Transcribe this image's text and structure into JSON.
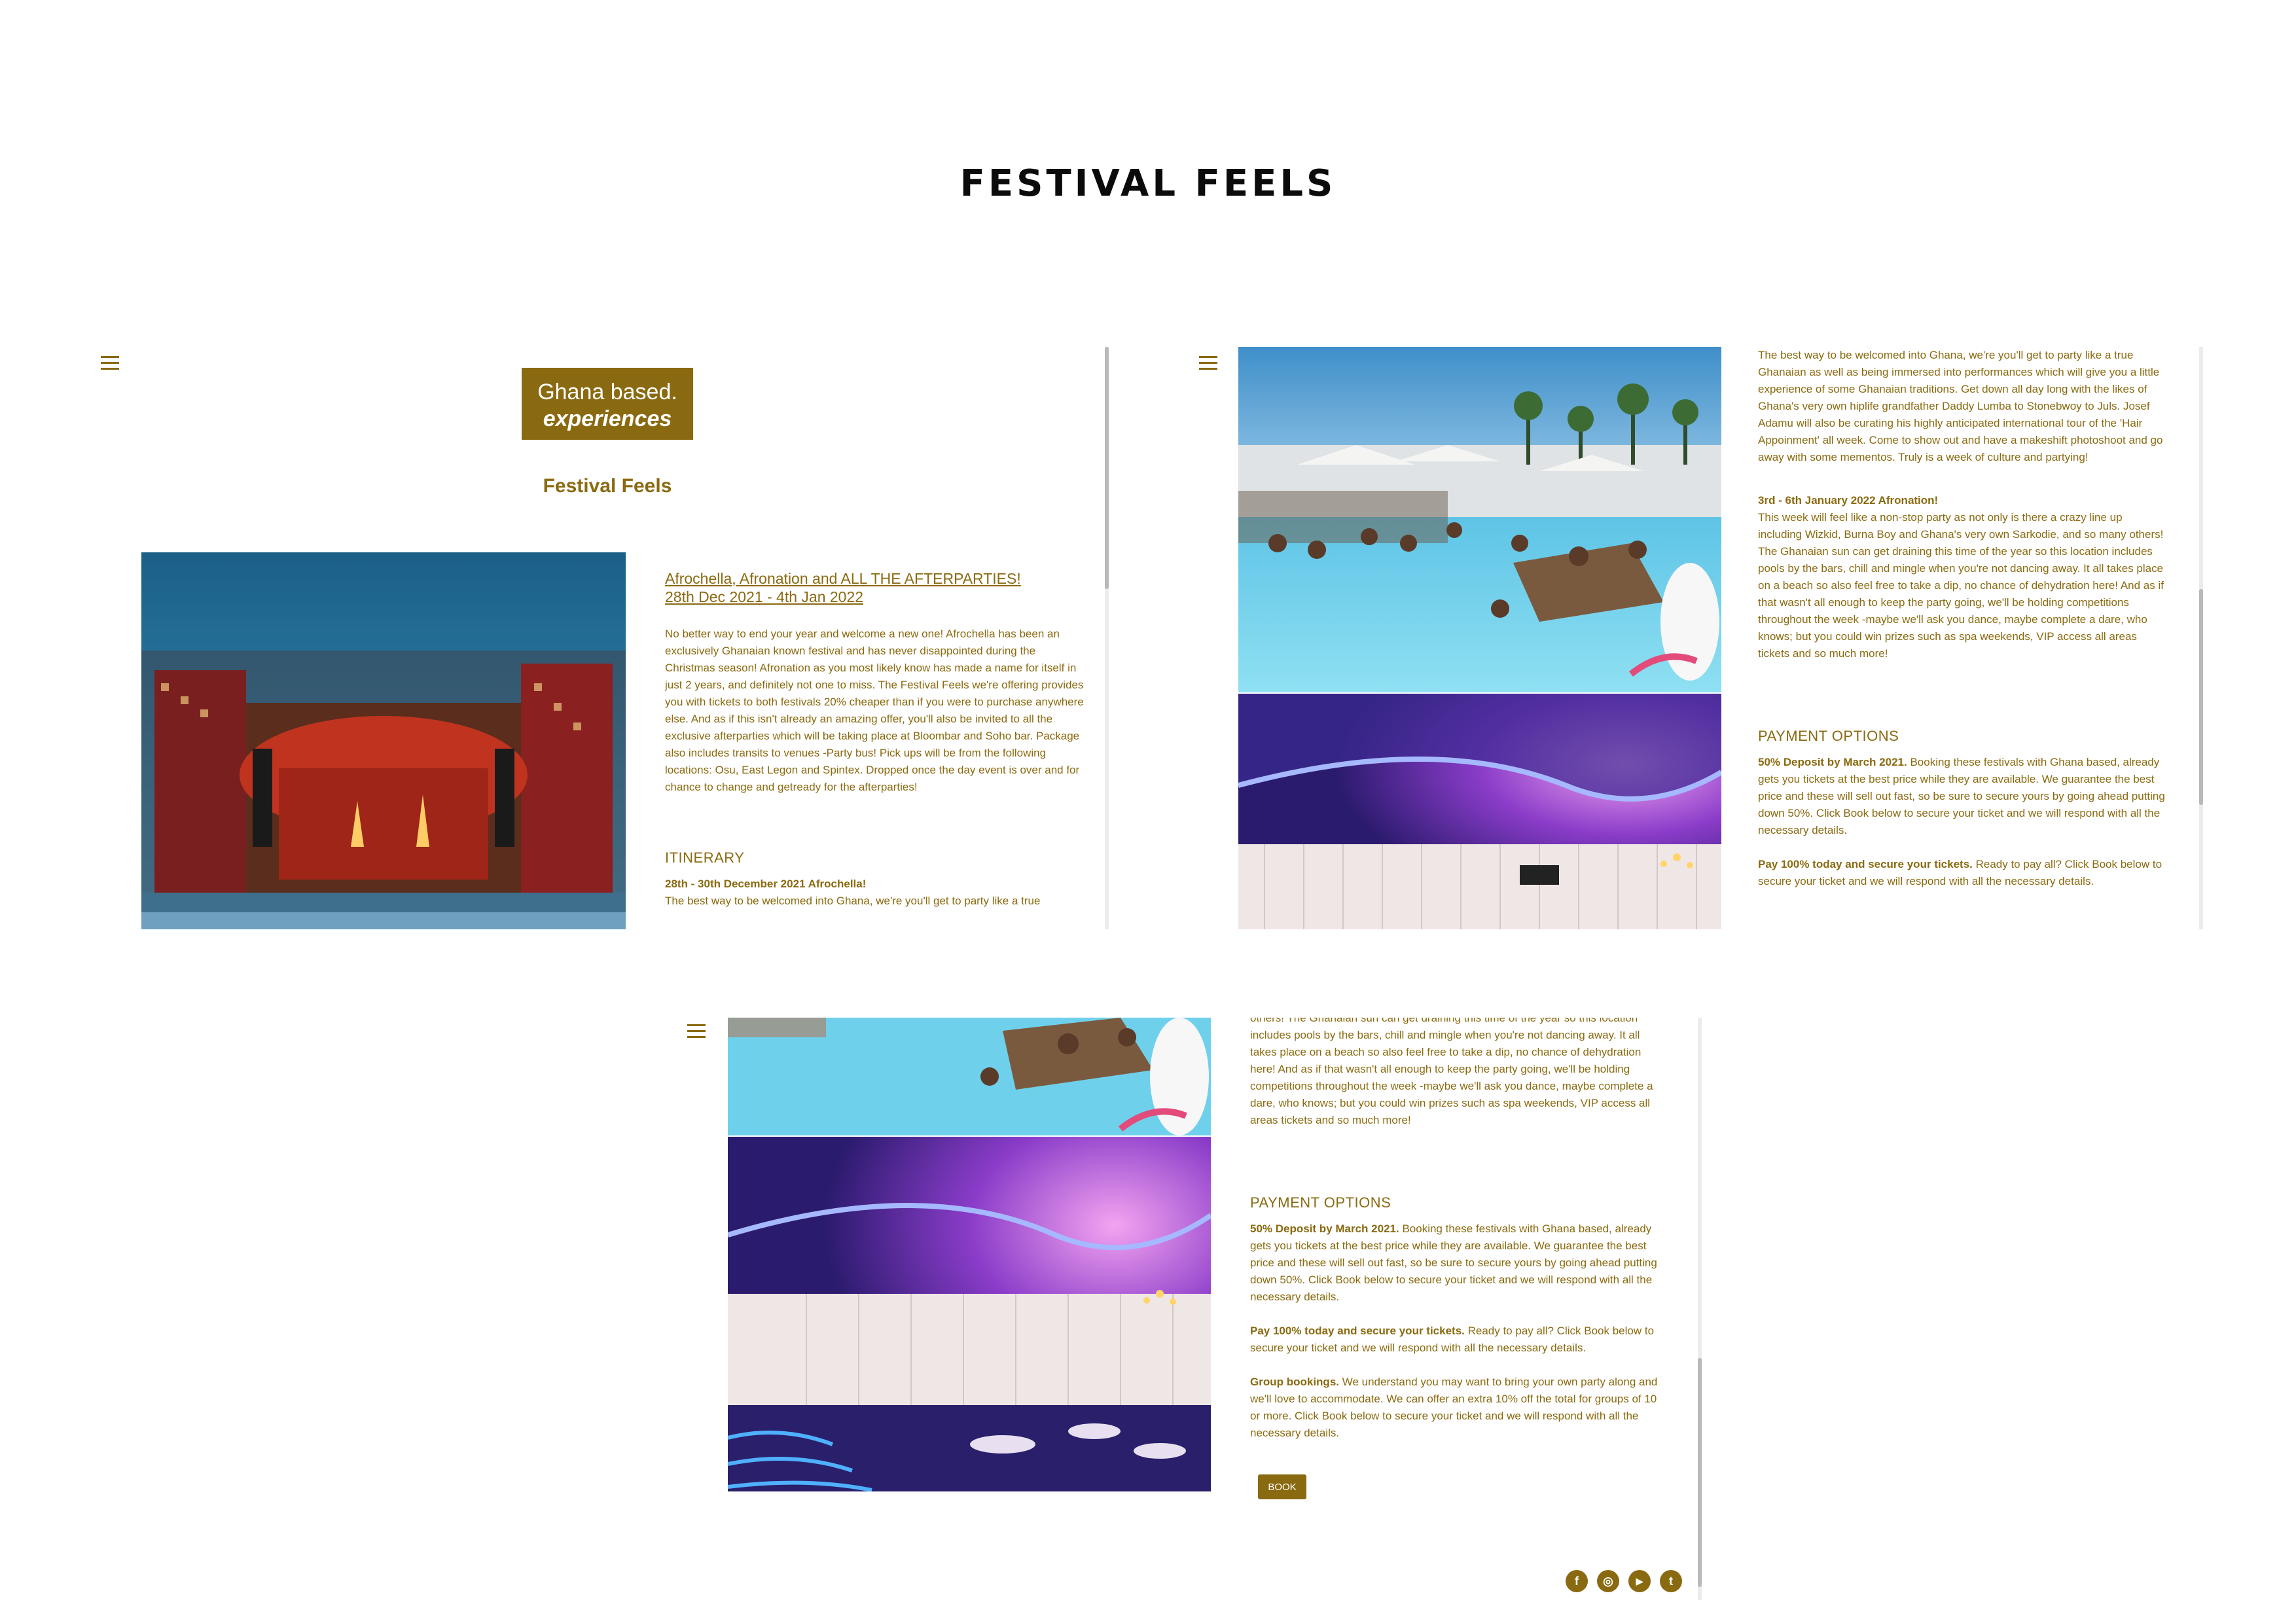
{
  "page": {
    "title": "FESTIVAL FEELS"
  },
  "logo": {
    "line1": "Ghana based.",
    "line2": "experiences"
  },
  "site": {
    "page_heading": "Festival Feels"
  },
  "event": {
    "link_line1": "Afrochella, Afronation and ALL THE AFTERPARTIES!",
    "link_line2": "28th Dec 2021 - 4th Jan 2022",
    "intro": "No better way to end your year and welcome a new one! Afrochella has been an exclusively Ghanaian known festival and has never disappointed during the Christmas season! Afronation as you most likely know has made a name for itself in just 2 years, and definitely not one to miss. The Festival Feels we're offering provides you with tickets to both festivals 20% cheaper than if you were to purchase anywhere else. And as if this isn't already an amazing offer, you'll also be invited to all the exclusive afterparties which will be taking place at Bloombar and Soho bar. Package also includes transits to venues -Party bus! Pick ups will be from the following locations: Osu, East Legon and Spintex. Dropped once the day event is over and for chance to change and getready for the afterparties!"
  },
  "itinerary": {
    "heading": "ITINERARY",
    "day1_title": "28th - 30th December 2021 Afrochella!",
    "day1_preview": "The best way to be welcomed into Ghana, we're you'll get to party like a true",
    "day1_text": "The best way to be welcomed into Ghana, we're you'll get to party like a true Ghanaian as well as being immersed into performances which will give you a little experience of some Ghanaian traditions. Get down all day long with the likes of Ghana's very own hiplife grandfather Daddy Lumba to Stonebwoy to Juls. Josef Adamu will also be curating his highly anticipated international tour of the 'Hair Appoinment' all week. Come to show out and have a makeshift photoshoot and go away with some mementos. Truly is a week of culture and partying!",
    "day2_title": "3rd - 6th January 2022 Afronation!",
    "day2_text": "This week will feel like a non-stop party as not only is there a crazy line up including Wizkid, Burna Boy and Ghana's very own Sarkodie, and so many others! The Ghanaian sun can get draining this time of the year so this location includes pools by the bars, chill and mingle when you're not dancing away. It all takes place on a beach so also feel free to take a dip, no chance of dehydration here! And as if that wasn't all enough to keep the party going, we'll be holding competitions throughout the week -maybe we'll ask you dance, maybe complete a dare, who knows; but you could win prizes such as spa weekends, VIP access all areas tickets and so much more!",
    "day2_partial_top": "others! The Ghanaian sun can get draining this time of the year so this location",
    "day2_partial_rest": "includes pools by the bars, chill and mingle when you're not dancing away. It all takes place on a beach so also feel free to take a dip, no chance of dehydration here! And as if that wasn't all enough to keep the party going, we'll be holding competitions throughout the week -maybe we'll ask you dance, maybe complete a dare, who knows; but you could win prizes such as spa weekends, VIP access all areas tickets and so much more!"
  },
  "payment": {
    "heading": "PAYMENT OPTIONS",
    "opt1_bold": "50% Deposit by March 2021.",
    "opt1_text": " Booking these festivals with Ghana based, already gets you tickets at the best price while they are available. We guarantee the best price and these will sell out fast, so be sure to secure yours by going ahead putting down 50%. Click Book below to secure your ticket and we will respond with all the necessary details.",
    "opt2_bold": "Pay 100% today and secure your tickets.",
    "opt2_text": " Ready to pay all? Click Book below to secure your ticket and we will respond with all the necessary details.",
    "opt3_bold": "Group bookings.",
    "opt3_text": " We understand you may want to bring your own party along and we'll love to accommodate. We can offer an extra 10% off the total for groups of 10 or more. Click Book below to secure your ticket and we will respond with all the necessary details."
  },
  "book": {
    "label": "BOOK"
  },
  "social": {
    "facebook": "f",
    "instagram": "◎",
    "youtube": "▶",
    "twitter": "t"
  },
  "colors": {
    "accent": "#8a6a10",
    "title": "#0b0b0b"
  }
}
